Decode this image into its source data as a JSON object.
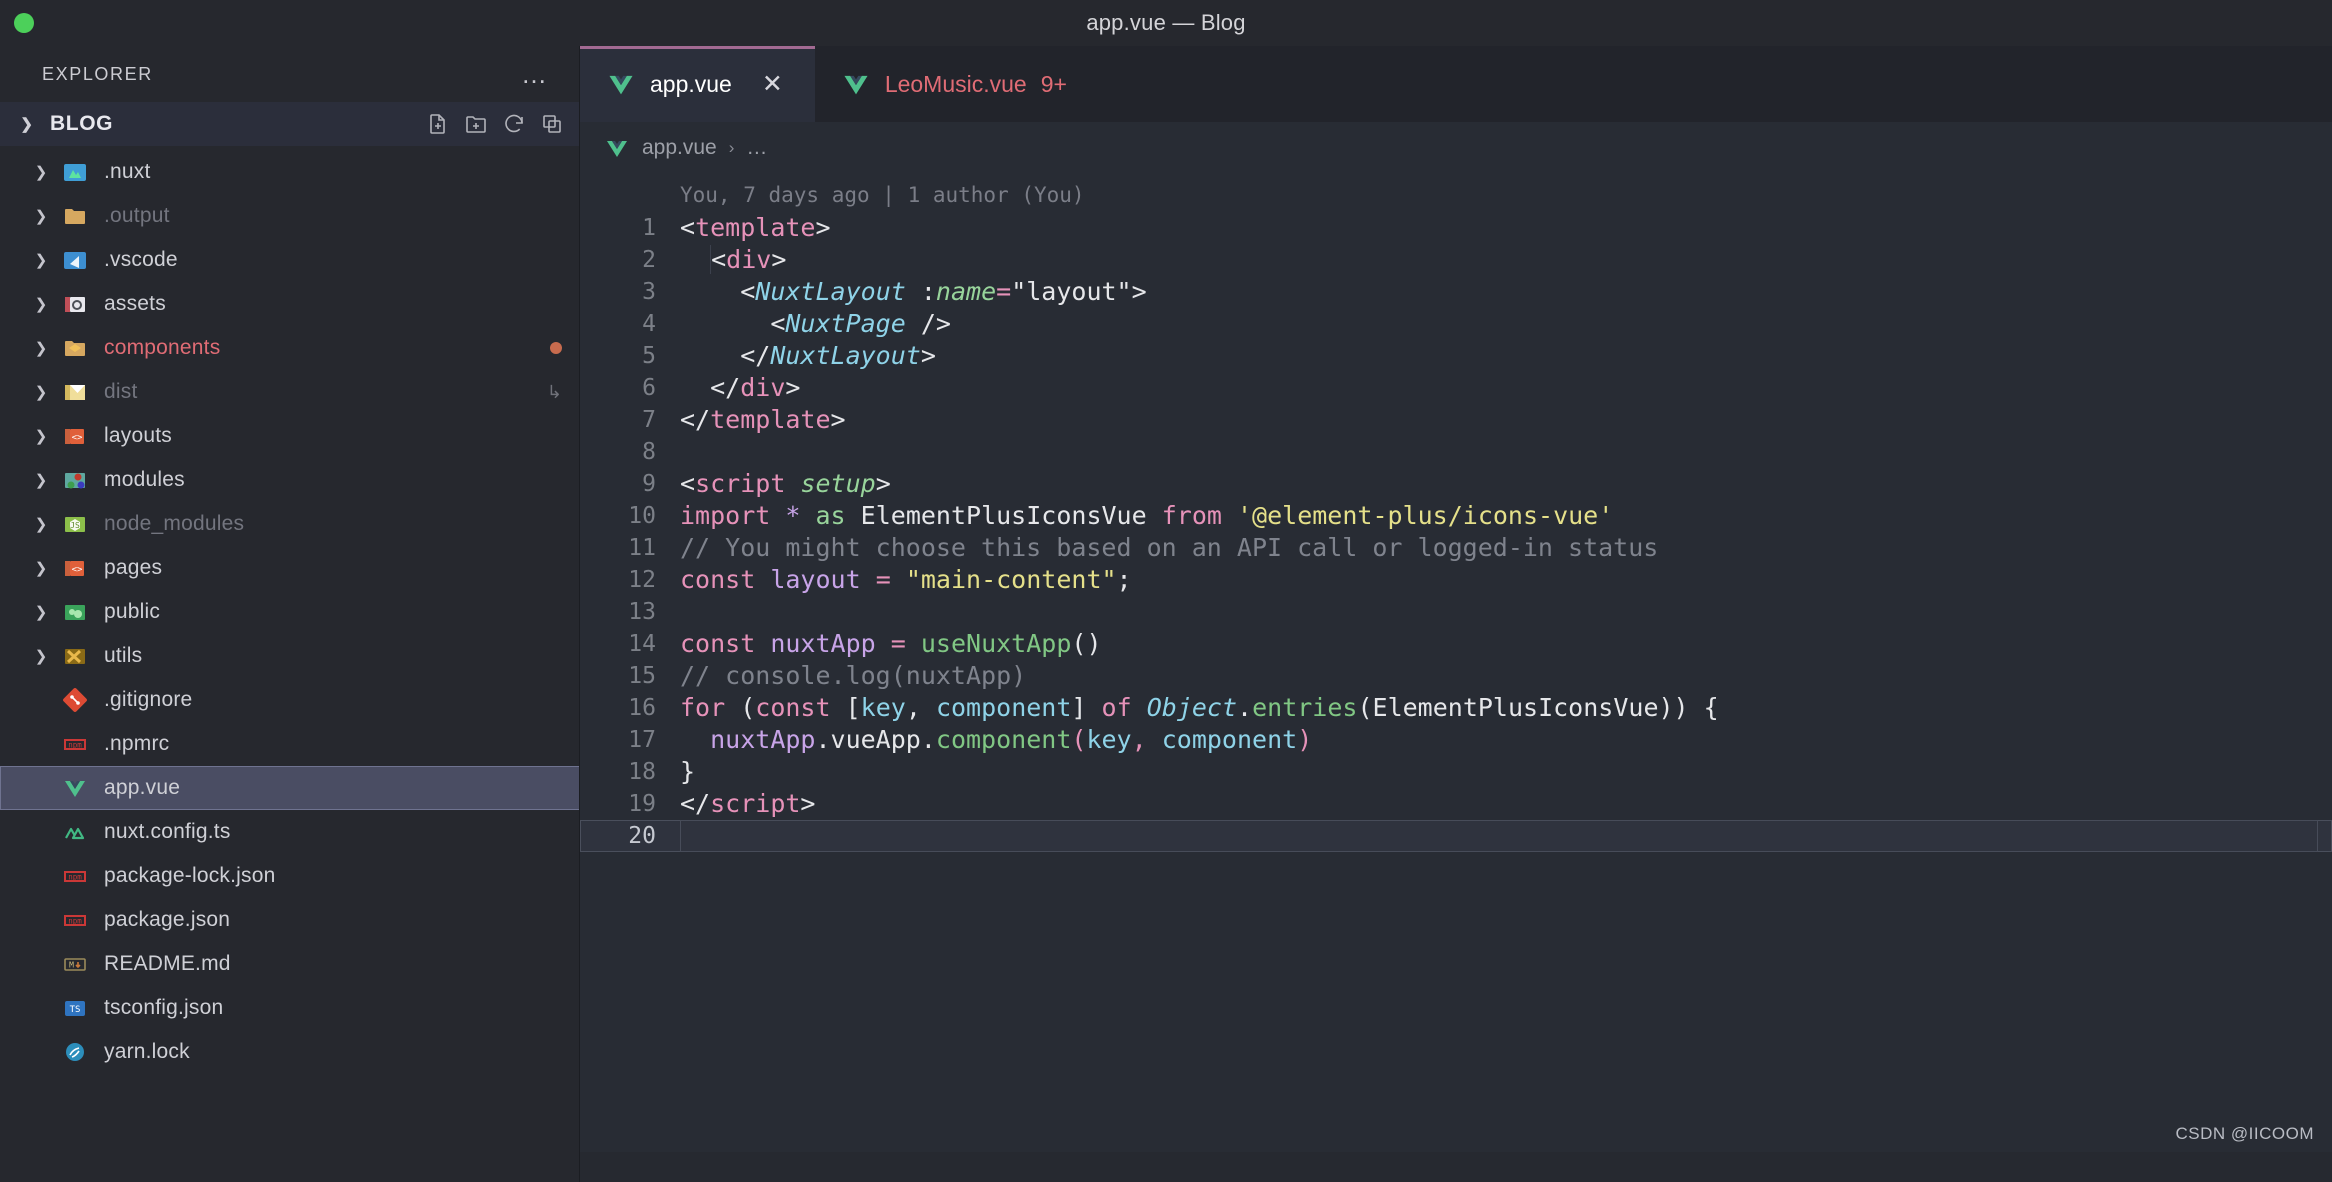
{
  "window": {
    "title": "app.vue — Blog"
  },
  "sidebar": {
    "header": {
      "label": "EXPLORER",
      "more_label": "…"
    },
    "folder": {
      "name": "BLOG",
      "actions": [
        "new-file-icon",
        "new-folder-icon",
        "refresh-icon",
        "collapse-all-icon"
      ]
    },
    "items": [
      {
        "label": ".nuxt",
        "icon": "nuxt-folder-icon",
        "expandable": true,
        "state": "normal"
      },
      {
        "label": ".output",
        "icon": "folder-icon",
        "expandable": true,
        "state": "ignored"
      },
      {
        "label": ".vscode",
        "icon": "vscode-folder-icon",
        "expandable": true,
        "state": "normal"
      },
      {
        "label": "assets",
        "icon": "assets-folder-icon",
        "expandable": true,
        "state": "normal"
      },
      {
        "label": "components",
        "icon": "components-folder-icon",
        "expandable": true,
        "state": "modified"
      },
      {
        "label": "dist",
        "icon": "dist-folder-icon",
        "expandable": true,
        "state": "ignored"
      },
      {
        "label": "layouts",
        "icon": "layouts-folder-icon",
        "expandable": true,
        "state": "normal"
      },
      {
        "label": "modules",
        "icon": "modules-folder-icon",
        "expandable": true,
        "state": "normal"
      },
      {
        "label": "node_modules",
        "icon": "node-folder-icon",
        "expandable": true,
        "state": "ignored"
      },
      {
        "label": "pages",
        "icon": "pages-folder-icon",
        "expandable": true,
        "state": "normal"
      },
      {
        "label": "public",
        "icon": "public-folder-icon",
        "expandable": true,
        "state": "normal"
      },
      {
        "label": "utils",
        "icon": "utils-folder-icon",
        "expandable": true,
        "state": "normal"
      },
      {
        "label": ".gitignore",
        "icon": "git-icon",
        "expandable": false,
        "state": "normal"
      },
      {
        "label": ".npmrc",
        "icon": "npm-icon",
        "expandable": false,
        "state": "normal"
      },
      {
        "label": "app.vue",
        "icon": "vue-icon",
        "expandable": false,
        "state": "selected"
      },
      {
        "label": "nuxt.config.ts",
        "icon": "nuxt-icon",
        "expandable": false,
        "state": "normal"
      },
      {
        "label": "package-lock.json",
        "icon": "npm-icon",
        "expandable": false,
        "state": "normal"
      },
      {
        "label": "package.json",
        "icon": "npm-icon",
        "expandable": false,
        "state": "normal"
      },
      {
        "label": "README.md",
        "icon": "markdown-icon",
        "expandable": false,
        "state": "normal"
      },
      {
        "label": "tsconfig.json",
        "icon": "tsconfig-icon",
        "expandable": false,
        "state": "normal"
      },
      {
        "label": "yarn.lock",
        "icon": "yarn-icon",
        "expandable": false,
        "state": "normal"
      }
    ]
  },
  "tabs": [
    {
      "label": "app.vue",
      "icon": "vue-icon",
      "active": true,
      "dirty": false,
      "badge": "",
      "close_label": "✕"
    },
    {
      "label": "LeoMusic.vue",
      "icon": "vue-icon",
      "active": false,
      "dirty": true,
      "badge": "9+",
      "close_label": ""
    }
  ],
  "breadcrumb": {
    "file": "app.vue",
    "separator": "›",
    "tail": "…"
  },
  "editor": {
    "blame": "You, 7 days ago | 1 author (You)",
    "line_numbers": [
      "1",
      "2",
      "3",
      "4",
      "5",
      "6",
      "7",
      "8",
      "9",
      "10",
      "11",
      "12",
      "13",
      "14",
      "15",
      "16",
      "17",
      "18",
      "19",
      "20"
    ],
    "current_line": "20",
    "lines": [
      "<template>",
      "  <div>",
      "    <NuxtLayout :name=\"layout\">",
      "      <NuxtPage />",
      "    </NuxtLayout>",
      "  </div>",
      "</template>",
      "",
      "<script setup>",
      "import * as ElementPlusIconsVue from '@element-plus/icons-vue'",
      "// You might choose this based on an API call or logged-in status",
      "const layout = \"main-content\";",
      "",
      "const nuxtApp = useNuxtApp()",
      "// console.log(nuxtApp)",
      "for (const [key, component] of Object.entries(ElementPlusIconsVue)) {",
      "  nuxtApp.vueApp.component(key, component)",
      "}",
      "</script>",
      ""
    ]
  },
  "watermark": "CSDN @IICOOM",
  "colors": {
    "accent": "#a26a92",
    "selection": "#4a4d63",
    "editor_bg": "#282c34",
    "sidebar_bg": "#26282e",
    "modified": "#e06c75"
  }
}
